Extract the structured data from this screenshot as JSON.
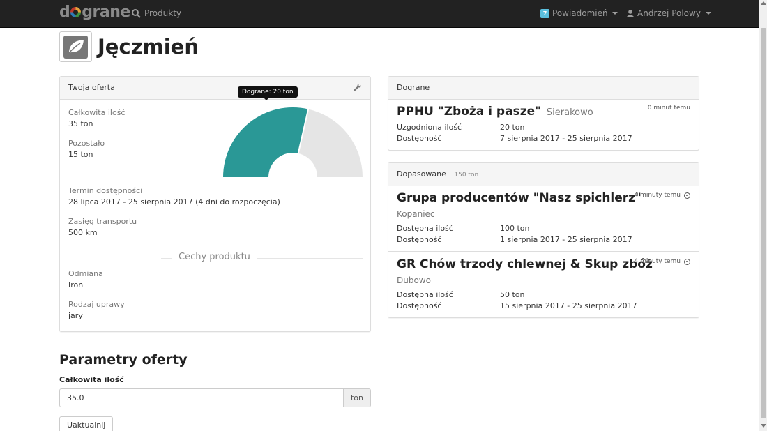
{
  "navbar": {
    "brand": "dograne",
    "products_label": "Produkty",
    "notif_count": "7",
    "notif_label": "Powiadomień",
    "user_label": "Andrzej Polowy"
  },
  "page": {
    "title": "Jęczmień",
    "icon": "leaf-icon"
  },
  "offer_panel": {
    "heading": "Twoja oferta",
    "tooltip": "Dograne: 20 ton",
    "gauge": {
      "total": 35,
      "dograne": 20,
      "fill_fraction": 0.571,
      "color": "#2a9896",
      "rest_color": "#e5e5e5"
    },
    "fields": [
      {
        "label": "Całkowita ilość",
        "value": "35 ton"
      },
      {
        "label": "Pozostało",
        "value": "15 ton"
      },
      {
        "label": "Termin dostępności",
        "value": "28 lipca 2017 - 25 sierpnia 2017 (4 dni do rozpoczęcia)"
      },
      {
        "label": "Zasięg transportu",
        "value": "500 km"
      }
    ],
    "features_title": "Cechy produktu",
    "features": [
      {
        "label": "Odmiana",
        "value": "Iron"
      },
      {
        "label": "Rodzaj uprawy",
        "value": "jary"
      }
    ]
  },
  "dograne_panel": {
    "heading": "Dograne",
    "item": {
      "name": "PPHU \"Zboża i pasze\"",
      "location": "Sierakowo",
      "time": "0 minut temu",
      "rows": [
        {
          "label": "Uzgodniona ilość",
          "value": "20 ton"
        },
        {
          "label": "Dostępność",
          "value": "7 sierpnia 2017 - 25 sierpnia 2017"
        }
      ]
    }
  },
  "matched_panel": {
    "heading": "Dopasowane",
    "sub": "150 ton",
    "items": [
      {
        "name": "Grupa producentów \"Nasz spichlerz\"",
        "location": "Kopaniec",
        "time": "4 minuty temu",
        "rows": [
          {
            "label": "Dostępna ilość",
            "value": "100 ton"
          },
          {
            "label": "Dostępność",
            "value": "1 sierpnia 2017 - 25 sierpnia 2017"
          }
        ]
      },
      {
        "name": "GR Chów trzody chlewnej & Skup zbóż",
        "location": "Dubowo",
        "time": "4 minuty temu",
        "rows": [
          {
            "label": "Dostępna ilość",
            "value": "50 ton"
          },
          {
            "label": "Dostępność",
            "value": "15 sierpnia 2017 - 25 sierpnia 2017"
          }
        ]
      }
    ]
  },
  "form": {
    "heading": "Parametry oferty",
    "label": "Całkowita ilość",
    "value": "35.0",
    "unit": "ton",
    "button": "Uaktualnij"
  }
}
